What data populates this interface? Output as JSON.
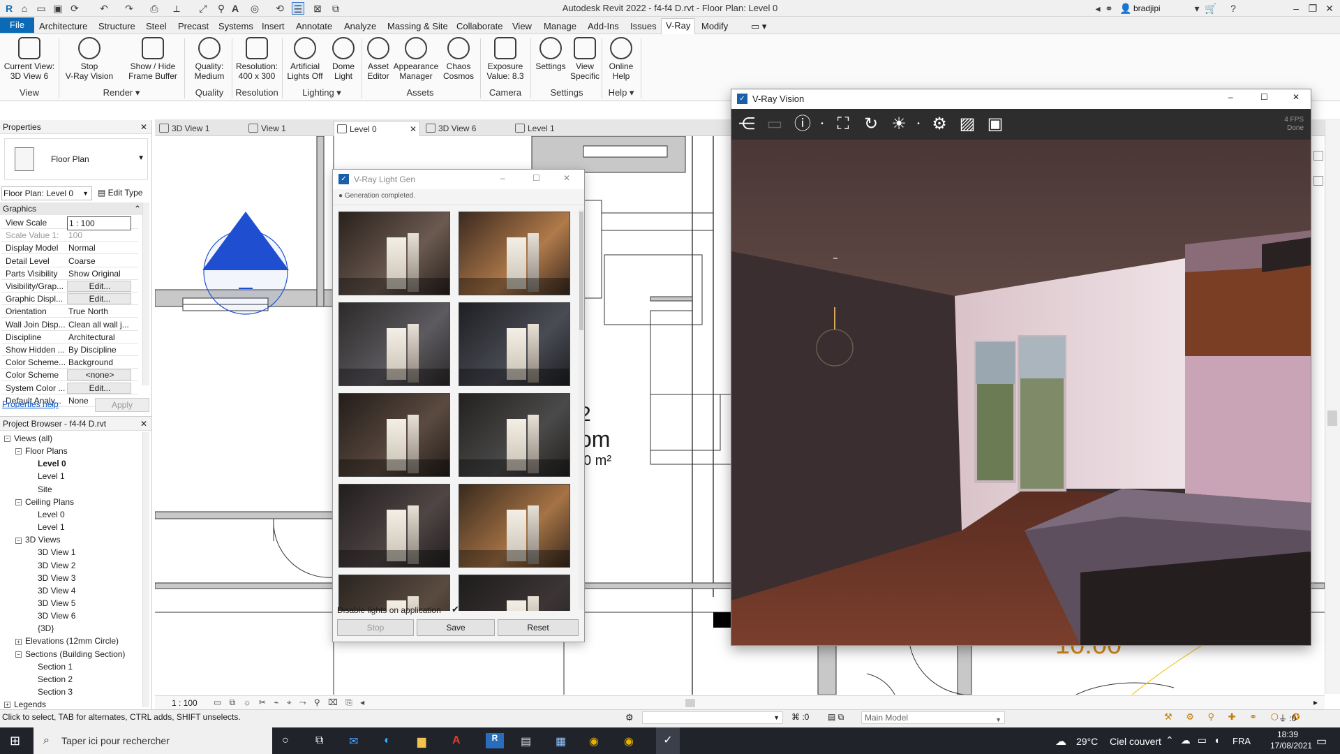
{
  "app": {
    "title": "Autodesk Revit 2022 - f4-f4 D.rvt - Floor Plan: Level 0",
    "user": "bradjipi"
  },
  "menu": {
    "tabs": [
      "File",
      "Architecture",
      "Structure",
      "Steel",
      "Precast",
      "Systems",
      "Insert",
      "Annotate",
      "Analyze",
      "Massing & Site",
      "Collaborate",
      "View",
      "Manage",
      "Add-Ins",
      "Issues",
      "V-Ray",
      "Modify"
    ]
  },
  "ribbon": {
    "buttons": [
      {
        "l1": "Current View:",
        "l2": "3D View 6"
      },
      {
        "l1": "Stop",
        "l2": "V-Ray Vision"
      },
      {
        "l1": "Show / Hide",
        "l2": "Frame Buffer"
      },
      {
        "l1": "Quality:",
        "l2": "Medium"
      },
      {
        "l1": "Resolution:",
        "l2": "400 x 300"
      },
      {
        "l1": "Artificial",
        "l2": "Lights Off"
      },
      {
        "l1": "Dome",
        "l2": "Light"
      },
      {
        "l1": "Asset",
        "l2": "Editor"
      },
      {
        "l1": "Appearance",
        "l2": "Manager"
      },
      {
        "l1": "Chaos",
        "l2": "Cosmos"
      },
      {
        "l1": "Exposure",
        "l2": "Value: 8.3"
      },
      {
        "l1": "Settings",
        "l2": ""
      },
      {
        "l1": "View",
        "l2": "Specific"
      },
      {
        "l1": "Online",
        "l2": "Help"
      }
    ],
    "panels": [
      "View",
      "Render ▾",
      "Quality",
      "Resolution",
      "Lighting ▾",
      "Assets",
      "Camera",
      "Settings",
      "Help ▾"
    ]
  },
  "viewtabs": [
    "3D View 1",
    "View 1",
    "Level 0",
    "3D View 6",
    "Level 1"
  ],
  "properties": {
    "title": "Properties",
    "type": "Floor Plan",
    "selector": "Floor Plan: Level 0",
    "edit_type": "Edit Type",
    "section": "Graphics",
    "rows": [
      {
        "k": "View Scale",
        "v": "1 : 100"
      },
      {
        "k": "Scale Value    1:",
        "v": "100"
      },
      {
        "k": "Display Model",
        "v": "Normal"
      },
      {
        "k": "Detail Level",
        "v": "Coarse"
      },
      {
        "k": "Parts Visibility",
        "v": "Show Original"
      },
      {
        "k": "Visibility/Grap...",
        "v": "Edit..."
      },
      {
        "k": "Graphic Displ...",
        "v": "Edit..."
      },
      {
        "k": "Orientation",
        "v": "True North"
      },
      {
        "k": "Wall Join Disp...",
        "v": "Clean all wall j..."
      },
      {
        "k": "Discipline",
        "v": "Architectural"
      },
      {
        "k": "Show Hidden ...",
        "v": "By Discipline"
      },
      {
        "k": "Color Scheme...",
        "v": "Background"
      },
      {
        "k": "Color Scheme",
        "v": "<none>"
      },
      {
        "k": "System Color ...",
        "v": "Edit..."
      },
      {
        "k": "Default Analy...",
        "v": "None"
      }
    ],
    "help": "Properties help",
    "apply": "Apply"
  },
  "browser": {
    "title": "Project Browser - f4-f4 D.rvt",
    "items": [
      {
        "t": "Views (all)",
        "lvl": 0,
        "tg": "-"
      },
      {
        "t": "Floor Plans",
        "lvl": 1,
        "tg": "-"
      },
      {
        "t": "Level 0",
        "lvl": 2,
        "tg": ""
      },
      {
        "t": "Level 1",
        "lvl": 2,
        "tg": ""
      },
      {
        "t": "Site",
        "lvl": 2,
        "tg": ""
      },
      {
        "t": "Ceiling Plans",
        "lvl": 1,
        "tg": "-"
      },
      {
        "t": "Level 0",
        "lvl": 2,
        "tg": ""
      },
      {
        "t": "Level 1",
        "lvl": 2,
        "tg": ""
      },
      {
        "t": "3D Views",
        "lvl": 1,
        "tg": "-"
      },
      {
        "t": "3D View 1",
        "lvl": 2,
        "tg": ""
      },
      {
        "t": "3D View 2",
        "lvl": 2,
        "tg": ""
      },
      {
        "t": "3D View 3",
        "lvl": 2,
        "tg": ""
      },
      {
        "t": "3D View 4",
        "lvl": 2,
        "tg": ""
      },
      {
        "t": "3D View 5",
        "lvl": 2,
        "tg": ""
      },
      {
        "t": "3D View 6",
        "lvl": 2,
        "tg": ""
      },
      {
        "t": "{3D}",
        "lvl": 2,
        "tg": ""
      },
      {
        "t": "Elevations (12mm Circle)",
        "lvl": 1,
        "tg": "+"
      },
      {
        "t": "Sections (Building Section)",
        "lvl": 1,
        "tg": "-"
      },
      {
        "t": "Section 1",
        "lvl": 2,
        "tg": ""
      },
      {
        "t": "Section 2",
        "lvl": 2,
        "tg": ""
      },
      {
        "t": "Section 3",
        "lvl": 2,
        "tg": ""
      },
      {
        "t": "Legends",
        "lvl": 0,
        "tg": "+"
      }
    ]
  },
  "drawing": {
    "room_num": "2",
    "room_name": "om",
    "room_area": "0 m²",
    "clock": "10:00",
    "scale": "1 : 100"
  },
  "lightgen": {
    "title": "V-Ray Light Gen",
    "status": "Generation completed.",
    "disable_label": "Disable lights on application",
    "stop": "Stop",
    "save": "Save",
    "reset": "Reset"
  },
  "vision": {
    "title": "V-Ray Vision",
    "fps": "4 FPS",
    "state": "Done"
  },
  "status": {
    "hint": "Click to select, TAB for alternates, CTRL adds, SHIFT unselects.",
    "count": ":0",
    "model": "Main Model",
    "filter": ":0"
  },
  "taskbar": {
    "search": "Taper ici pour rechercher",
    "temp": "29°C",
    "weather": "Ciel couvert",
    "lang": "FRA",
    "time": "18:39",
    "date": "17/08/2021"
  },
  "colors": {
    "accent": "#0b69b5",
    "vray_bar": "#2d2d2d"
  }
}
